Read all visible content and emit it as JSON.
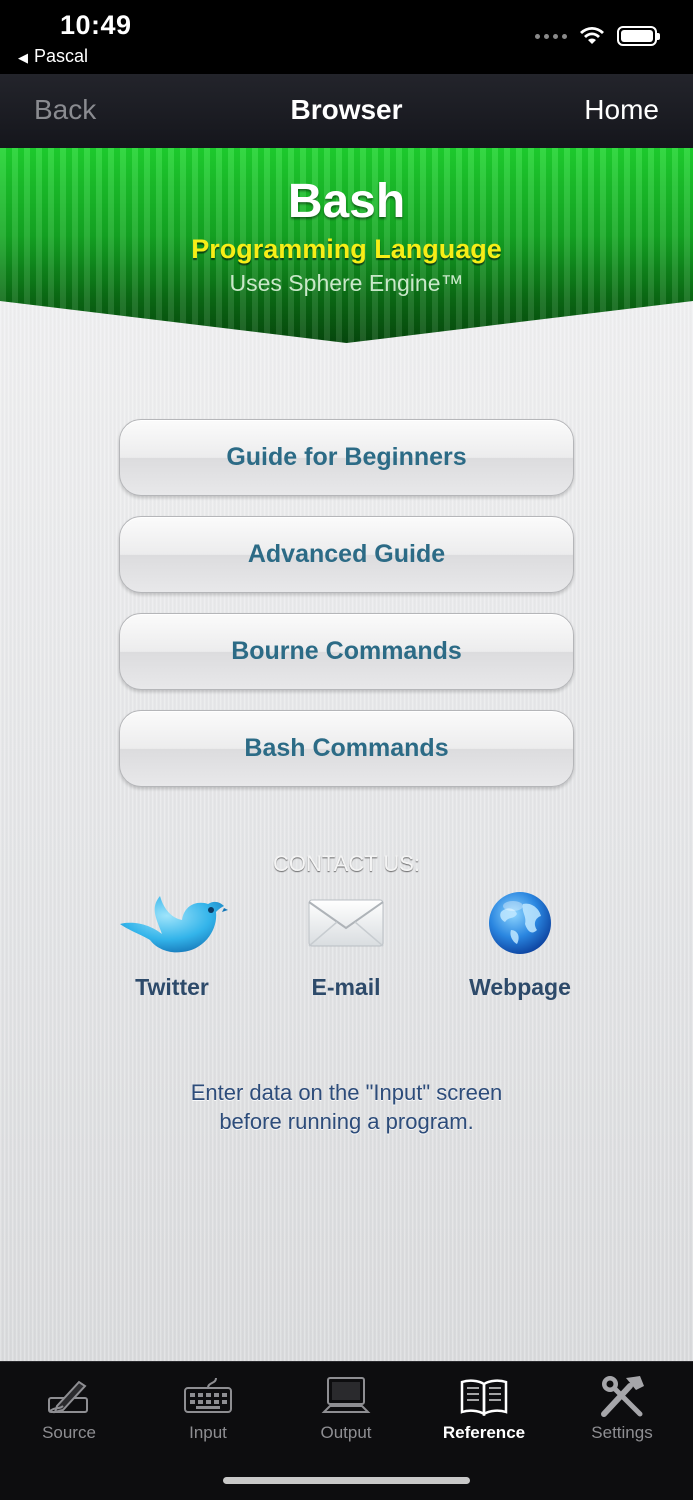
{
  "status": {
    "time": "10:49",
    "back_app": "Pascal"
  },
  "nav": {
    "back": "Back",
    "title": "Browser",
    "home": "Home"
  },
  "banner": {
    "title": "Bash",
    "subtitle": "Programming Language",
    "engine": "Uses Sphere Engine™"
  },
  "guides": [
    {
      "label": "Guide for Beginners"
    },
    {
      "label": "Advanced Guide"
    },
    {
      "label": "Bourne Commands"
    },
    {
      "label": "Bash Commands"
    }
  ],
  "contact": {
    "heading": "CONTACT US:",
    "items": [
      {
        "label": "Twitter",
        "icon": "twitter-bird-icon"
      },
      {
        "label": "E-mail",
        "icon": "envelope-icon"
      },
      {
        "label": "Webpage",
        "icon": "globe-icon"
      }
    ]
  },
  "note": {
    "line1": "Enter data on the \"Input\" screen",
    "line2": "before running a program."
  },
  "tabs": [
    {
      "label": "Source",
      "icon": "pen-icon"
    },
    {
      "label": "Input",
      "icon": "keyboard-icon"
    },
    {
      "label": "Output",
      "icon": "monitor-icon"
    },
    {
      "label": "Reference",
      "icon": "book-icon",
      "active": true
    },
    {
      "label": "Settings",
      "icon": "tools-icon"
    }
  ],
  "colors": {
    "banner_green": "#14a823",
    "subtitle_yellow": "#f7ee17",
    "button_text": "#2c6b86",
    "tab_bar": "#0d0d0f"
  }
}
